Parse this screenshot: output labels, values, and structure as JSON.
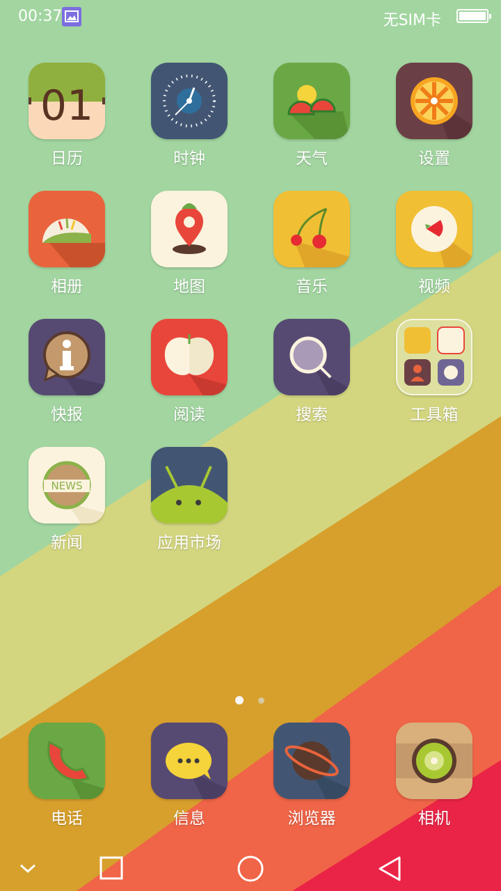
{
  "status_bar": {
    "time": "00:37",
    "carrier": "无SIM卡"
  },
  "apps": [
    {
      "name": "calendar-app",
      "label": "日历",
      "icon": "calendar-icon",
      "date_text": "01"
    },
    {
      "name": "clock-app",
      "label": "时钟",
      "icon": "clock-icon"
    },
    {
      "name": "weather-app",
      "label": "天气",
      "icon": "weather-icon"
    },
    {
      "name": "settings-app",
      "label": "设置",
      "icon": "settings-icon"
    },
    {
      "name": "gallery-app",
      "label": "相册",
      "icon": "gallery-icon"
    },
    {
      "name": "maps-app",
      "label": "地图",
      "icon": "map-pin-icon"
    },
    {
      "name": "music-app",
      "label": "音乐",
      "icon": "music-icon"
    },
    {
      "name": "video-app",
      "label": "视频",
      "icon": "video-icon"
    },
    {
      "name": "news-brief-app",
      "label": "快报",
      "icon": "info-icon"
    },
    {
      "name": "reader-app",
      "label": "阅读",
      "icon": "book-icon"
    },
    {
      "name": "search-app",
      "label": "搜索",
      "icon": "search-icon"
    },
    {
      "name": "toolbox-folder",
      "label": "工具箱",
      "icon": "folder-icon"
    },
    {
      "name": "news-app",
      "label": "新闻",
      "icon": "news-icon",
      "badge_text": "NEWS"
    },
    {
      "name": "app-market-app",
      "label": "应用市场",
      "icon": "android-icon"
    }
  ],
  "dock": [
    {
      "name": "phone-app",
      "label": "电话",
      "icon": "phone-icon"
    },
    {
      "name": "messages-app",
      "label": "信息",
      "icon": "chat-icon"
    },
    {
      "name": "browser-app",
      "label": "浏览器",
      "icon": "planet-icon"
    },
    {
      "name": "camera-app",
      "label": "相机",
      "icon": "camera-icon"
    }
  ],
  "page_indicator": {
    "pages": 2,
    "current": 1
  },
  "nav_bar": [
    "collapse-chevron-icon",
    "recents-square-icon",
    "home-circle-icon",
    "back-triangle-icon"
  ]
}
